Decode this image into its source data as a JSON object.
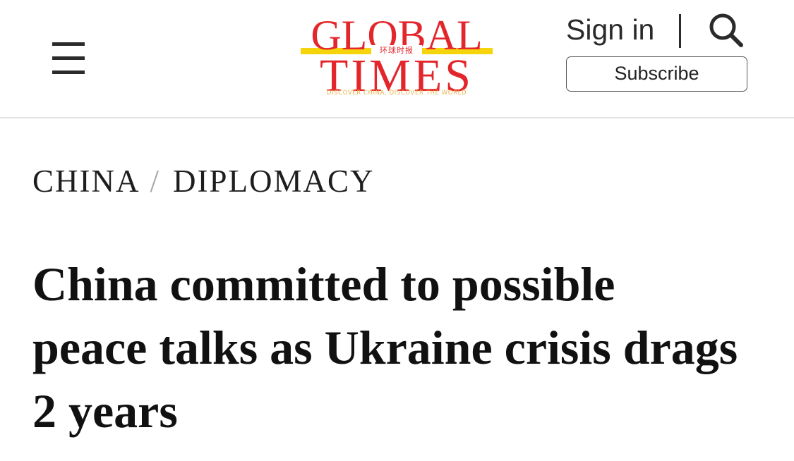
{
  "header": {
    "menu_icon": "hamburger-menu-icon",
    "logo": {
      "line1": "GLOBAL",
      "line2": "TIMES",
      "chinese": "环球时报",
      "tagline": "DISCOVER CHINA, DISCOVER THE WORLD",
      "brand_red": "#e3262b",
      "brand_yellow": "#f6d40b"
    },
    "signin_label": "Sign in",
    "search_icon": "search-icon",
    "subscribe_label": "Subscribe"
  },
  "breadcrumb": {
    "section": "CHINA",
    "separator": "/",
    "subsection": "DIPLOMACY"
  },
  "article": {
    "headline": "China committed to possible peace talks as Ukraine crisis drags 2 years"
  }
}
